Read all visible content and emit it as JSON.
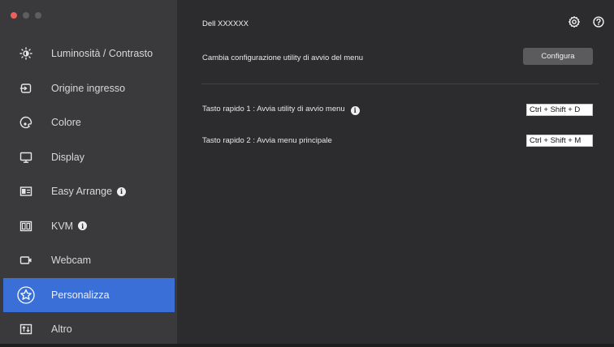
{
  "window": {
    "title": "Dell XXXXXX"
  },
  "sidebar": {
    "items": [
      {
        "label": "Luminosità / Contrasto",
        "icon": "brightness-icon",
        "info": false,
        "active": false
      },
      {
        "label": "Origine ingresso",
        "icon": "input-source-icon",
        "info": false,
        "active": false
      },
      {
        "label": "Colore",
        "icon": "color-icon",
        "info": false,
        "active": false
      },
      {
        "label": "Display",
        "icon": "display-icon",
        "info": false,
        "active": false
      },
      {
        "label": "Easy Arrange",
        "icon": "easy-arrange-icon",
        "info": true,
        "active": false
      },
      {
        "label": "KVM",
        "icon": "kvm-icon",
        "info": true,
        "active": false
      },
      {
        "label": "Webcam",
        "icon": "webcam-icon",
        "info": false,
        "active": false
      },
      {
        "label": "Personalizza",
        "icon": "star-icon",
        "info": false,
        "active": true
      },
      {
        "label": "Altro",
        "icon": "other-icon",
        "info": false,
        "active": false
      }
    ]
  },
  "main": {
    "configure_row": {
      "label": "Cambia configurazione utility di avvio del menu",
      "button": "Configura"
    },
    "hotkey1": {
      "label": "Tasto rapido 1 : Avvia utility di avvio menu",
      "value": "Ctrl + Shift + D"
    },
    "hotkey2": {
      "label": "Tasto rapido 2 : Avvia menu principale",
      "value": "Ctrl + Shift + M"
    }
  },
  "colors": {
    "accent": "#3a6fd8",
    "sidebar": "#3a3a3c",
    "content": "#2c2c2e"
  }
}
